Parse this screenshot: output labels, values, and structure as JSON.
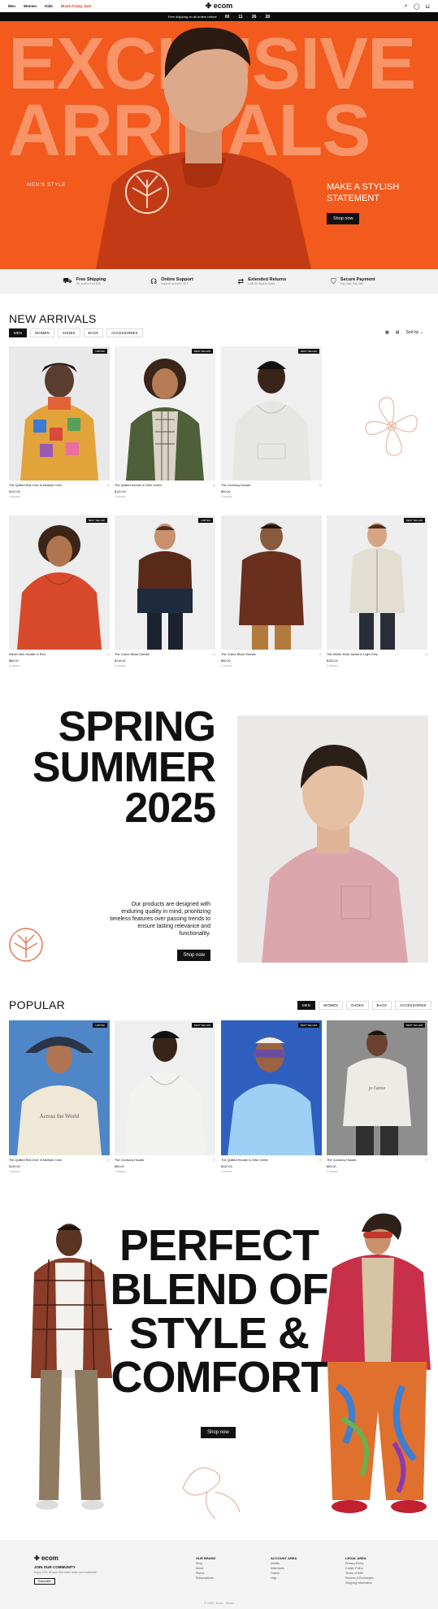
{
  "header": {
    "nav": [
      "Men",
      "Women",
      "Kids",
      "Black Friday Sale"
    ],
    "logo": "ecom",
    "icons": [
      "search-icon",
      "user-icon",
      "cart-icon"
    ]
  },
  "promo": {
    "text": "Free shipping on all orders before",
    "countdown": [
      "00",
      "11",
      "26",
      "28"
    ]
  },
  "hero": {
    "bg_text_1": "EXCLUSIVE",
    "bg_text_2": "ARRIVALS",
    "tag": "MEN'S STYLE",
    "statement": "MAKE A STYLISH STATEMENT",
    "cta": "Shop now"
  },
  "features": [
    {
      "icon": "truck-icon",
      "title": "Free Shipping",
      "sub": "On orders over $40"
    },
    {
      "icon": "headset-icon",
      "title": "Online Support",
      "sub": "Support anytime 24/7"
    },
    {
      "icon": "returns-icon",
      "title": "Extended Returns",
      "sub": "Until 30 days in sales"
    },
    {
      "icon": "shield-icon",
      "title": "Secure Payment",
      "sub": "Pay now. Pay later"
    }
  ],
  "new_arrivals": {
    "title": "NEW ARRIVALS",
    "tabs": [
      "MEN",
      "WOMEN",
      "SHOES",
      "BAGS",
      "ACCESSORIES"
    ],
    "sort": "Sort by",
    "products": [
      {
        "badge": "LIMITED",
        "name": "The Quilted Roll-Over In Multiple Color",
        "price": "$120.00",
        "colors": "4 colours"
      },
      {
        "badge": "BEST SELLER",
        "name": "The Quilted Hoodie In Olive Green",
        "price": "$120.00",
        "colors": "3 colours"
      },
      {
        "badge": "BEST SELLER",
        "name": "The Corduroy Hoodie",
        "price": "$90.00",
        "colors": "2 colours"
      },
      {
        "badge": "BEST SELLER",
        "name": "Winter Skin Hoodie In Red",
        "price": "$80.00",
        "colors": "2 colours"
      },
      {
        "badge": "LIMITED",
        "name": "The Colour Block Sweats",
        "price": "$110.00",
        "colors": "3 colours"
      },
      {
        "badge": "",
        "name": "The Colour Block Sweats",
        "price": "$90.00",
        "colors": "2 colours"
      },
      {
        "badge": "BEST SELLER",
        "name": "The Winter Khali Jacket In Light Grey",
        "price": "$120.00",
        "colors": "3 colours"
      }
    ]
  },
  "spring": {
    "line1": "SPRING",
    "line2": "SUMMER",
    "line3": "2025",
    "body": "Our products are designed with enduring quality in mind, prioritizing timeless features over passing trends to ensure lasting relevance and functionality.",
    "cta": "Shop now"
  },
  "popular": {
    "title": "POPULAR",
    "tabs": [
      "MEN",
      "WOMEN",
      "SHOES",
      "BAGS",
      "ACCESSORIES"
    ],
    "products": [
      {
        "badge": "LIMITED",
        "name": "The Quilted Roll-Over In Multiple Color",
        "price": "$120.00",
        "colors": "4 colours"
      },
      {
        "badge": "BEST SELLER",
        "name": "The Corduroy Hoodie",
        "price": "$90.00",
        "colors": "2 colours"
      },
      {
        "badge": "BEST SELLER",
        "name": "The Quilted Hoodie In Olive Green",
        "price": "$120.00",
        "colors": "3 colours"
      },
      {
        "badge": "BEST SELLER",
        "name": "The Corduroy Hoodie",
        "price": "$90.00",
        "colors": "2 colours"
      }
    ]
  },
  "blend": {
    "line1": "PERFECT",
    "line2": "BLEND OF",
    "line3": "STYLE &",
    "line4": "COMFORT",
    "cta": "Shop now"
  },
  "footer": {
    "logo": "ecom",
    "join": "JOIN OUR COMMUNITY",
    "join_text": "Enjoy 10% off your first order when you subscribe",
    "subscribe": "Subscribe",
    "cols": [
      {
        "title": "OUR BRAND",
        "items": [
          "Shop",
          "About",
          "Stores",
          "Subscriptions"
        ]
      },
      {
        "title": "ACCOUNT AREA",
        "items": [
          "Details",
          "Addresses",
          "Orders",
          "Help"
        ]
      },
      {
        "title": "LEGAL AREA",
        "items": [
          "Privacy Policy",
          "Cookie Policy",
          "Terms of Sale",
          "Returns & Exchanges",
          "Shipping Information"
        ]
      }
    ],
    "copyright": "© 2025 · Ecom · Studio"
  }
}
